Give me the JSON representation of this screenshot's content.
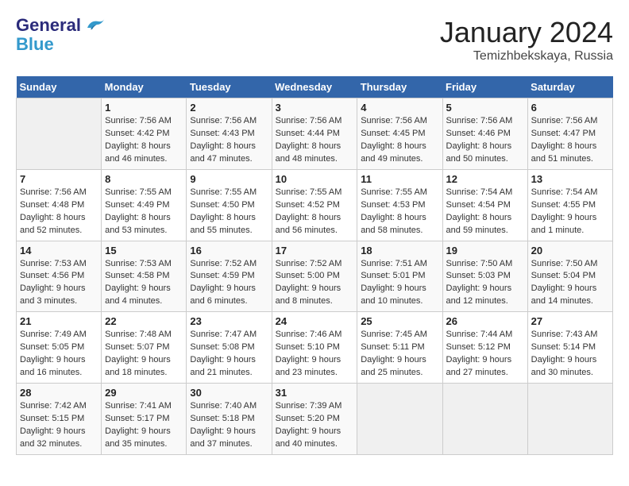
{
  "logo": {
    "general": "General",
    "blue": "Blue"
  },
  "title": "January 2024",
  "subtitle": "Temizhbekskaya, Russia",
  "days_of_week": [
    "Sunday",
    "Monday",
    "Tuesday",
    "Wednesday",
    "Thursday",
    "Friday",
    "Saturday"
  ],
  "weeks": [
    [
      {
        "day": "",
        "info": ""
      },
      {
        "day": "1",
        "info": "Sunrise: 7:56 AM\nSunset: 4:42 PM\nDaylight: 8 hours\nand 46 minutes."
      },
      {
        "day": "2",
        "info": "Sunrise: 7:56 AM\nSunset: 4:43 PM\nDaylight: 8 hours\nand 47 minutes."
      },
      {
        "day": "3",
        "info": "Sunrise: 7:56 AM\nSunset: 4:44 PM\nDaylight: 8 hours\nand 48 minutes."
      },
      {
        "day": "4",
        "info": "Sunrise: 7:56 AM\nSunset: 4:45 PM\nDaylight: 8 hours\nand 49 minutes."
      },
      {
        "day": "5",
        "info": "Sunrise: 7:56 AM\nSunset: 4:46 PM\nDaylight: 8 hours\nand 50 minutes."
      },
      {
        "day": "6",
        "info": "Sunrise: 7:56 AM\nSunset: 4:47 PM\nDaylight: 8 hours\nand 51 minutes."
      }
    ],
    [
      {
        "day": "7",
        "info": "Sunrise: 7:56 AM\nSunset: 4:48 PM\nDaylight: 8 hours\nand 52 minutes."
      },
      {
        "day": "8",
        "info": "Sunrise: 7:55 AM\nSunset: 4:49 PM\nDaylight: 8 hours\nand 53 minutes."
      },
      {
        "day": "9",
        "info": "Sunrise: 7:55 AM\nSunset: 4:50 PM\nDaylight: 8 hours\nand 55 minutes."
      },
      {
        "day": "10",
        "info": "Sunrise: 7:55 AM\nSunset: 4:52 PM\nDaylight: 8 hours\nand 56 minutes."
      },
      {
        "day": "11",
        "info": "Sunrise: 7:55 AM\nSunset: 4:53 PM\nDaylight: 8 hours\nand 58 minutes."
      },
      {
        "day": "12",
        "info": "Sunrise: 7:54 AM\nSunset: 4:54 PM\nDaylight: 8 hours\nand 59 minutes."
      },
      {
        "day": "13",
        "info": "Sunrise: 7:54 AM\nSunset: 4:55 PM\nDaylight: 9 hours\nand 1 minute."
      }
    ],
    [
      {
        "day": "14",
        "info": "Sunrise: 7:53 AM\nSunset: 4:56 PM\nDaylight: 9 hours\nand 3 minutes."
      },
      {
        "day": "15",
        "info": "Sunrise: 7:53 AM\nSunset: 4:58 PM\nDaylight: 9 hours\nand 4 minutes."
      },
      {
        "day": "16",
        "info": "Sunrise: 7:52 AM\nSunset: 4:59 PM\nDaylight: 9 hours\nand 6 minutes."
      },
      {
        "day": "17",
        "info": "Sunrise: 7:52 AM\nSunset: 5:00 PM\nDaylight: 9 hours\nand 8 minutes."
      },
      {
        "day": "18",
        "info": "Sunrise: 7:51 AM\nSunset: 5:01 PM\nDaylight: 9 hours\nand 10 minutes."
      },
      {
        "day": "19",
        "info": "Sunrise: 7:50 AM\nSunset: 5:03 PM\nDaylight: 9 hours\nand 12 minutes."
      },
      {
        "day": "20",
        "info": "Sunrise: 7:50 AM\nSunset: 5:04 PM\nDaylight: 9 hours\nand 14 minutes."
      }
    ],
    [
      {
        "day": "21",
        "info": "Sunrise: 7:49 AM\nSunset: 5:05 PM\nDaylight: 9 hours\nand 16 minutes."
      },
      {
        "day": "22",
        "info": "Sunrise: 7:48 AM\nSunset: 5:07 PM\nDaylight: 9 hours\nand 18 minutes."
      },
      {
        "day": "23",
        "info": "Sunrise: 7:47 AM\nSunset: 5:08 PM\nDaylight: 9 hours\nand 21 minutes."
      },
      {
        "day": "24",
        "info": "Sunrise: 7:46 AM\nSunset: 5:10 PM\nDaylight: 9 hours\nand 23 minutes."
      },
      {
        "day": "25",
        "info": "Sunrise: 7:45 AM\nSunset: 5:11 PM\nDaylight: 9 hours\nand 25 minutes."
      },
      {
        "day": "26",
        "info": "Sunrise: 7:44 AM\nSunset: 5:12 PM\nDaylight: 9 hours\nand 27 minutes."
      },
      {
        "day": "27",
        "info": "Sunrise: 7:43 AM\nSunset: 5:14 PM\nDaylight: 9 hours\nand 30 minutes."
      }
    ],
    [
      {
        "day": "28",
        "info": "Sunrise: 7:42 AM\nSunset: 5:15 PM\nDaylight: 9 hours\nand 32 minutes."
      },
      {
        "day": "29",
        "info": "Sunrise: 7:41 AM\nSunset: 5:17 PM\nDaylight: 9 hours\nand 35 minutes."
      },
      {
        "day": "30",
        "info": "Sunrise: 7:40 AM\nSunset: 5:18 PM\nDaylight: 9 hours\nand 37 minutes."
      },
      {
        "day": "31",
        "info": "Sunrise: 7:39 AM\nSunset: 5:20 PM\nDaylight: 9 hours\nand 40 minutes."
      },
      {
        "day": "",
        "info": ""
      },
      {
        "day": "",
        "info": ""
      },
      {
        "day": "",
        "info": ""
      }
    ]
  ]
}
